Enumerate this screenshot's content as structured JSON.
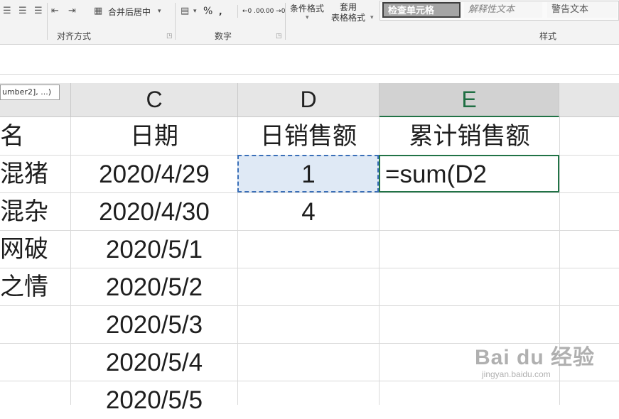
{
  "ribbon": {
    "align_group_label": "对齐方式",
    "number_group_label": "数字",
    "styles_group_label": "样式",
    "merge_center_label": "合并后居中",
    "percent_symbol": "%",
    "comma_symbol": ",",
    "increase_decimal": "←0 .00",
    "decrease_decimal": ".00 →0",
    "conditional_format_label": "条件格式",
    "table_format_line1": "套用",
    "table_format_line2": "表格格式",
    "styles": {
      "check_cell": "检查单元格",
      "explanatory_text": "解释性文本",
      "warning_text": "警告文本"
    },
    "colors": {
      "check_cell_bg": "#a5a5a5",
      "check_cell_fg": "#ffffff",
      "explanatory_fg": "#7f7f7f",
      "warning_fg": "#555555"
    }
  },
  "tooltip": {
    "text": "umber2], ...)"
  },
  "grid": {
    "columns": [
      {
        "name": "C",
        "selected": false
      },
      {
        "name": "D",
        "selected": false
      },
      {
        "name": "E",
        "selected": true
      }
    ],
    "header_row": {
      "b": "名",
      "c": "日期",
      "d": "日销售额",
      "e": "累计销售额"
    },
    "rows": [
      {
        "b": "混猪",
        "c": "2020/4/29",
        "d": "1",
        "e": "=sum(D2"
      },
      {
        "b": "混杂",
        "c": "2020/4/30",
        "d": "4",
        "e": ""
      },
      {
        "b": "网破",
        "c": "2020/5/1",
        "d": "",
        "e": ""
      },
      {
        "b": "之情",
        "c": "2020/5/2",
        "d": "",
        "e": ""
      },
      {
        "b": "",
        "c": "2020/5/3",
        "d": "",
        "e": ""
      },
      {
        "b": "",
        "c": "2020/5/4",
        "d": "",
        "e": ""
      },
      {
        "b": "",
        "c": "2020/5/5",
        "d": "",
        "e": ""
      }
    ],
    "colors": {
      "accent": "#217346",
      "copy_border": "#3a6fb8",
      "copy_fill": "#dfe9f5"
    }
  },
  "watermark": {
    "main": "Bai du 经验",
    "sub": "jingyan.baidu.com"
  }
}
